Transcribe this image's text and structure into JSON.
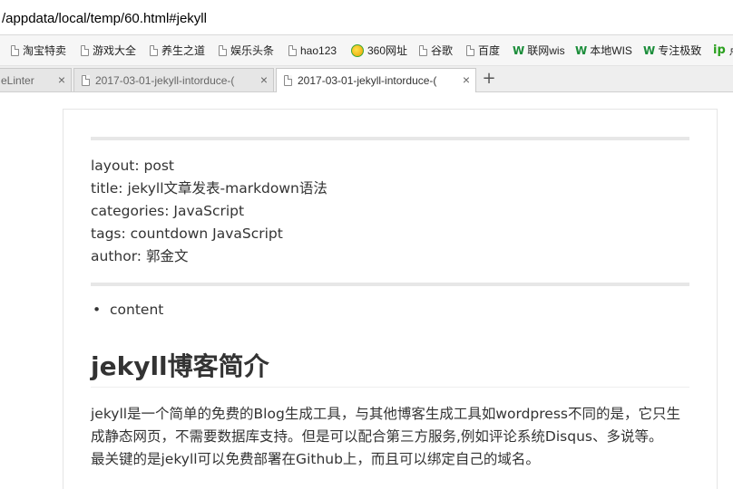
{
  "address_bar": {
    "url": "/appdata/local/temp/60.html#jekyll"
  },
  "bookmarks": [
    {
      "label": "淘宝特卖",
      "icon": "page-icon"
    },
    {
      "label": "游戏大全",
      "icon": "page-icon"
    },
    {
      "label": "养生之道",
      "icon": "page-icon"
    },
    {
      "label": "娱乐头条",
      "icon": "page-icon"
    },
    {
      "label": "hao123",
      "icon": "page-icon"
    },
    {
      "label": "360网址",
      "icon": "360-icon"
    },
    {
      "label": "谷歌",
      "icon": "page-icon"
    },
    {
      "label": "百度",
      "icon": "page-icon"
    },
    {
      "label": "联网wis",
      "icon": "w-icon"
    },
    {
      "label": "本地WIS",
      "icon": "w-icon"
    },
    {
      "label": "专注极致",
      "icon": "w-icon"
    },
    {
      "label": "点",
      "icon": "ip-icon"
    }
  ],
  "tabs": [
    {
      "title": "eLinter",
      "active": false
    },
    {
      "title": "2017-03-01-jekyll-intorduce-(",
      "active": false
    },
    {
      "title": "2017-03-01-jekyll-intorduce-(",
      "active": true
    }
  ],
  "tab_close_glyph": "×",
  "new_tab_glyph": "+",
  "content": {
    "front_matter": [
      "layout: post",
      "title: jekyll文章发表-markdown语法",
      "categories: JavaScript",
      "tags: countdown JavaScript",
      "author: 郭金文"
    ],
    "list_items": [
      "content"
    ],
    "heading": "jekyll博客简介",
    "paragraph_lines": [
      "jekyll是一个简单的免费的Blog生成工具，与其他博客生成工具如wordpress不同的是，它只生",
      "成静态网页，不需要数据库支持。但是可以配合第三方服务,例如评论系统Disqus、多说等。",
      "最关键的是jekyll可以免费部署在Github上，而且可以绑定自己的域名。"
    ]
  }
}
